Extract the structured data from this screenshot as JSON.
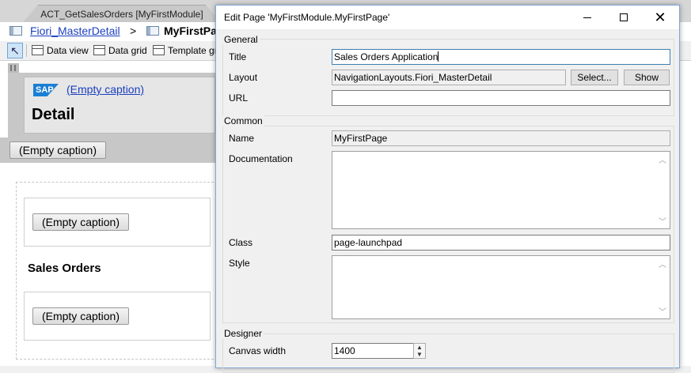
{
  "ide": {
    "tab_title": "ACT_GetSalesOrders [MyFirstModule]",
    "breadcrumb_link": "Fiori_MasterDetail",
    "breadcrumb_sep": ">",
    "breadcrumb_current": "MyFirstPa",
    "toolbar": {
      "pointer": "↖",
      "data_view": "Data view",
      "data_grid": "Data grid",
      "template_grid": "Template gr"
    },
    "header_caption": "(Empty caption)",
    "sap_logo_text": "SAP",
    "detail_title": "Detail",
    "strip_button": "(Empty caption)",
    "box1_button": "(Empty caption)",
    "sales_orders_heading": "Sales Orders",
    "box2_button": "(Empty caption)"
  },
  "dialog": {
    "title": "Edit Page 'MyFirstModule.MyFirstPage'",
    "close_glyph": "✕",
    "general": {
      "legend": "General",
      "title_label": "Title",
      "title_value": "Sales Orders Application",
      "layout_label": "Layout",
      "layout_value": "NavigationLayouts.Fiori_MasterDetail",
      "select_button": "Select...",
      "show_button": "Show",
      "url_label": "URL",
      "url_value": ""
    },
    "common": {
      "legend": "Common",
      "name_label": "Name",
      "name_value": "MyFirstPage",
      "documentation_label": "Documentation",
      "documentation_value": "",
      "class_label": "Class",
      "class_value": "page-launchpad",
      "style_label": "Style",
      "style_value": ""
    },
    "designer": {
      "legend": "Designer",
      "canvas_width_label": "Canvas width",
      "canvas_width_value": "1400"
    }
  }
}
